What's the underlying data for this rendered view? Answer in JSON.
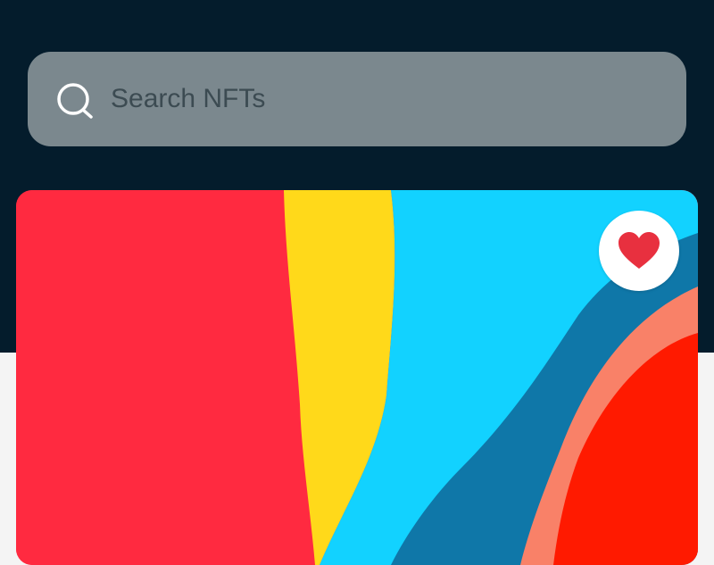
{
  "search": {
    "placeholder": "Search NFTs",
    "value": "",
    "icon": "search-icon"
  },
  "nft_card": {
    "favorite_icon": "heart-icon",
    "favorited": true
  },
  "colors": {
    "header_background": "#041c2c",
    "search_background": "#7b888e",
    "page_background": "#f4f4f4",
    "heart": "#e8303f",
    "art_red": "#ff2a40",
    "art_yellow": "#ffd91a",
    "art_cyan": "#12d2ff",
    "art_blue": "#0f77a8",
    "art_salmon": "#f98168",
    "art_deep_red": "#ff1a00"
  }
}
